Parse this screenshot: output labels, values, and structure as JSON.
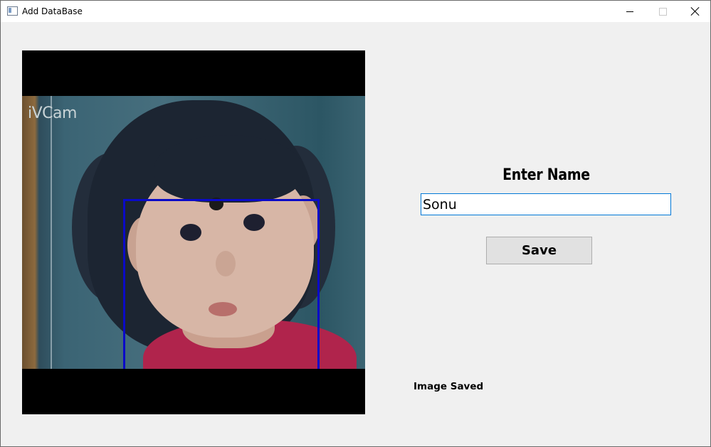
{
  "window": {
    "title": "Add DataBase",
    "controls": {
      "minimize": "minimize-icon",
      "maximize": "maximize-icon",
      "close": "close-icon"
    }
  },
  "camera": {
    "watermark": "iVCam",
    "face_box_color": "#0a0ac8"
  },
  "form": {
    "name_label": "Enter Name",
    "name_value": "Sonu",
    "save_label": "Save",
    "status_text": "Image Saved"
  },
  "colors": {
    "window_bg": "#f0f0f0",
    "input_focus_border": "#0078d7",
    "button_bg": "#e1e1e1"
  }
}
